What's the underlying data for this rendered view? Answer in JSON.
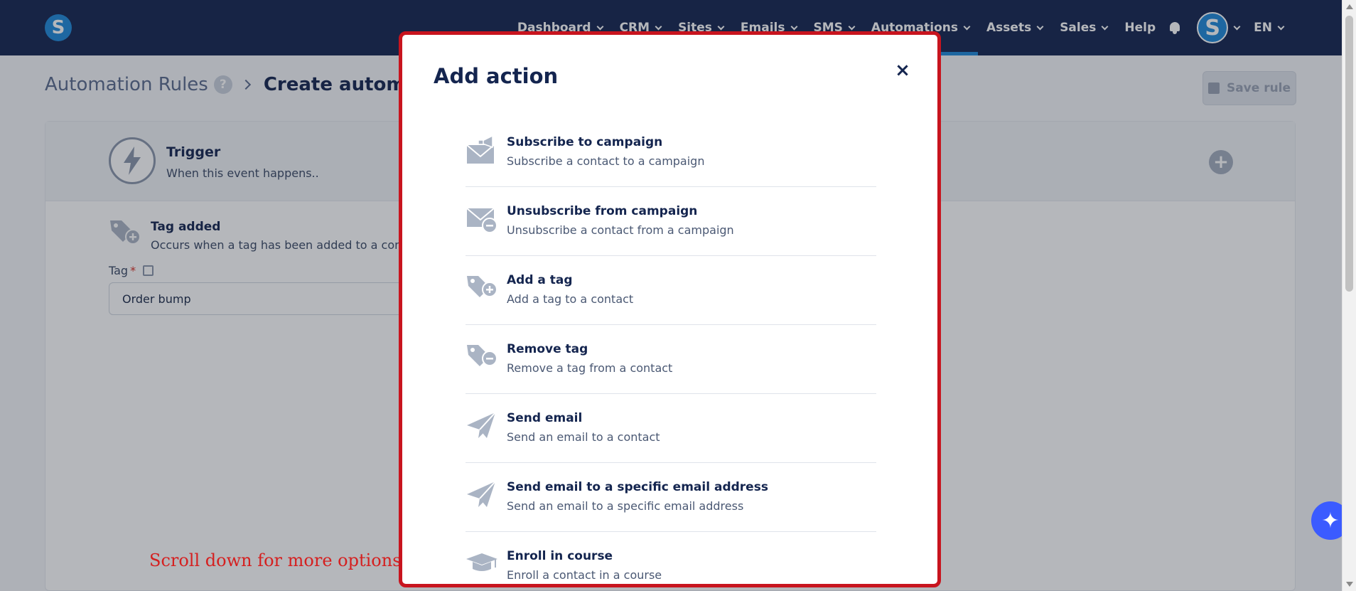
{
  "navbar": {
    "brand_letter": "S",
    "items": [
      {
        "label": "Dashboard",
        "dropdown": true
      },
      {
        "label": "CRM",
        "dropdown": true
      },
      {
        "label": "Sites",
        "dropdown": true
      },
      {
        "label": "Emails",
        "dropdown": true
      },
      {
        "label": "SMS",
        "dropdown": true
      },
      {
        "label": "Automations",
        "dropdown": true,
        "active": true
      },
      {
        "label": "Assets",
        "dropdown": true
      },
      {
        "label": "Sales",
        "dropdown": true
      },
      {
        "label": "Help",
        "dropdown": false
      }
    ],
    "avatar_letter": "S",
    "language": "EN"
  },
  "breadcrumb": {
    "root": "Automation Rules",
    "help": "?",
    "current": "Create automation"
  },
  "toolbar": {
    "save_label": "Save rule"
  },
  "trigger": {
    "title": "Trigger",
    "subtitle": "When this event happens..",
    "event_title": "Tag added",
    "event_desc": "Occurs when a tag has been added to a contact",
    "tag_label": "Tag",
    "tag_required": "*",
    "tag_value": "Order bump"
  },
  "scroll_hint": "Scroll down for more options",
  "modal": {
    "title": "Add action",
    "close": "×",
    "actions": [
      {
        "title": "Subscribe to campaign",
        "desc": "Subscribe a contact to a campaign",
        "icon": "envelope-megaphone-icon"
      },
      {
        "title": "Unsubscribe from campaign",
        "desc": "Unsubscribe a contact from a campaign",
        "icon": "envelope-minus-icon"
      },
      {
        "title": "Add a tag",
        "desc": "Add a tag to a contact",
        "icon": "tag-plus-icon"
      },
      {
        "title": "Remove tag",
        "desc": "Remove a tag from a contact",
        "icon": "tag-minus-icon"
      },
      {
        "title": "Send email",
        "desc": "Send an email to a contact",
        "icon": "paper-plane-icon"
      },
      {
        "title": "Send email to a specific email address",
        "desc": "Send an email to a specific email address",
        "icon": "paper-plane-icon"
      },
      {
        "title": "Enroll in course",
        "desc": "Enroll a contact in a course",
        "icon": "graduation-cap-icon"
      }
    ]
  },
  "colors": {
    "navbar_bg": "#14254f",
    "accent": "#1e88d8",
    "highlight": "#c8141e",
    "icon_gray": "#aab4c4"
  }
}
